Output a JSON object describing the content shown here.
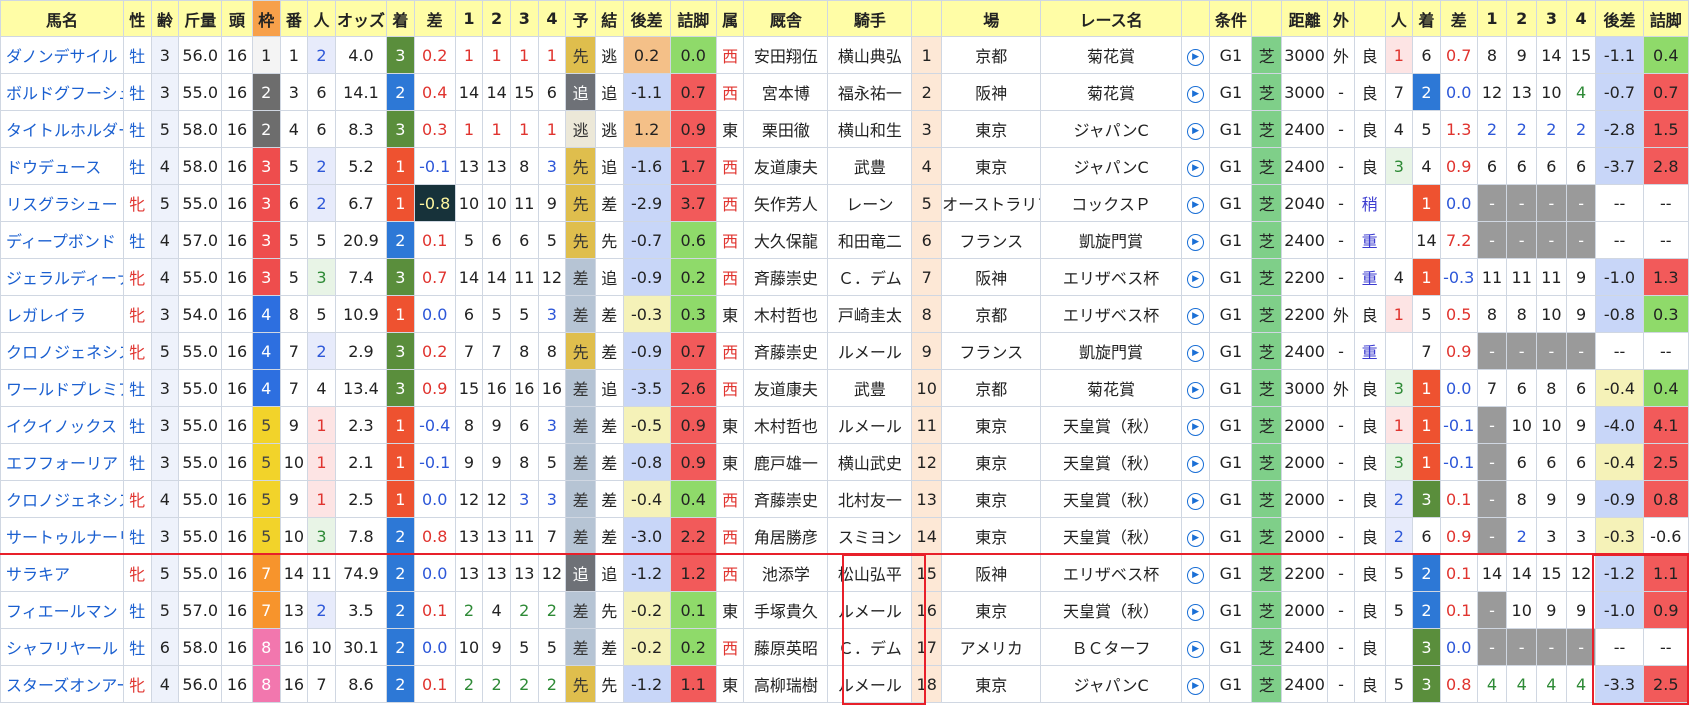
{
  "headers": [
    "馬名",
    "性",
    "齢",
    "斤量",
    "頭",
    "枠",
    "番",
    "人",
    "オッズ",
    "着",
    "差",
    "1",
    "2",
    "3",
    "4",
    "予",
    "結",
    "後差",
    "詰脚",
    "属",
    "厩舎",
    "騎手",
    "",
    "場",
    "レース名",
    "",
    "条件",
    "",
    "距離",
    "外",
    "",
    "人",
    "着",
    "差",
    "1",
    "2",
    "3",
    "4",
    "後差",
    "詰脚"
  ],
  "rows": [
    {
      "name": "ダノンデサイル",
      "sex": "牡",
      "age": "3",
      "wt": "56.0",
      "field": "16",
      "frame": "1",
      "num": "1",
      "pop": "2",
      "odds": "4.0",
      "fin": "3",
      "diff": "0.2",
      "c1": "1",
      "c2": "1",
      "c3": "1",
      "c4": "1",
      "pred": "先",
      "res": "逃",
      "gap": "0.2",
      "ts": "0.0",
      "org": "西",
      "trainer": "安田翔伍",
      "jockey": "横山典弘",
      "idx": "1",
      "venue": "京都",
      "race": "菊花賞",
      "grade": "G1",
      "surf": "芝",
      "dist": "3000",
      "out": "外",
      "cond": "良",
      "ppop": "1",
      "pfin": "6",
      "pdiff": "0.7",
      "pc1": "8",
      "pc2": "9",
      "pc3": "14",
      "pc4": "15",
      "pgap": "-1.1",
      "pts": "0.4"
    },
    {
      "name": "ボルドグフーシュ",
      "sex": "牡",
      "age": "3",
      "wt": "55.0",
      "field": "16",
      "frame": "2",
      "num": "3",
      "pop": "6",
      "odds": "14.1",
      "fin": "2",
      "diff": "0.4",
      "c1": "14",
      "c2": "14",
      "c3": "15",
      "c4": "6",
      "pred": "追",
      "res": "追",
      "gap": "-1.1",
      "ts": "0.7",
      "org": "西",
      "trainer": "宮本博",
      "jockey": "福永祐一",
      "idx": "2",
      "venue": "阪神",
      "race": "菊花賞",
      "grade": "G1",
      "surf": "芝",
      "dist": "3000",
      "out": "-",
      "cond": "良",
      "ppop": "7",
      "pfin": "2",
      "pdiff": "0.0",
      "pc1": "12",
      "pc2": "13",
      "pc3": "10",
      "pc4": "4",
      "pgap": "-0.7",
      "pts": "0.7"
    },
    {
      "name": "タイトルホルダー",
      "sex": "牡",
      "age": "5",
      "wt": "58.0",
      "field": "16",
      "frame": "2",
      "num": "4",
      "pop": "6",
      "odds": "8.3",
      "fin": "3",
      "diff": "0.3",
      "c1": "1",
      "c2": "1",
      "c3": "1",
      "c4": "1",
      "pred": "逃",
      "res": "逃",
      "gap": "1.2",
      "ts": "0.9",
      "org": "東",
      "trainer": "栗田徹",
      "jockey": "横山和生",
      "idx": "3",
      "venue": "東京",
      "race": "ジャパンC",
      "grade": "G1",
      "surf": "芝",
      "dist": "2400",
      "out": "-",
      "cond": "良",
      "ppop": "4",
      "pfin": "5",
      "pdiff": "1.3",
      "pc1": "2",
      "pc2": "2",
      "pc3": "2",
      "pc4": "2",
      "pgap": "-2.8",
      "pts": "1.5"
    },
    {
      "name": "ドウデュース",
      "sex": "牡",
      "age": "4",
      "wt": "58.0",
      "field": "16",
      "frame": "3",
      "num": "5",
      "pop": "2",
      "odds": "5.2",
      "fin": "1",
      "diff": "-0.1",
      "c1": "13",
      "c2": "13",
      "c3": "8",
      "c4": "3",
      "pred": "先",
      "res": "追",
      "gap": "-1.6",
      "ts": "1.7",
      "org": "西",
      "trainer": "友道康夫",
      "jockey": "武豊",
      "idx": "4",
      "venue": "東京",
      "race": "ジャパンC",
      "grade": "G1",
      "surf": "芝",
      "dist": "2400",
      "out": "-",
      "cond": "良",
      "ppop": "3",
      "pfin": "4",
      "pdiff": "0.9",
      "pc1": "6",
      "pc2": "6",
      "pc3": "6",
      "pc4": "6",
      "pgap": "-3.7",
      "pts": "2.8"
    },
    {
      "name": "リスグラシュー",
      "sex": "牝",
      "age": "5",
      "wt": "55.0",
      "field": "16",
      "frame": "3",
      "num": "6",
      "pop": "2",
      "odds": "6.7",
      "fin": "1",
      "diff": "-0.8",
      "c1": "10",
      "c2": "10",
      "c3": "11",
      "c4": "9",
      "pred": "先",
      "res": "差",
      "gap": "-2.9",
      "ts": "3.7",
      "org": "西",
      "trainer": "矢作芳人",
      "jockey": "レーン",
      "idx": "5",
      "venue": "オーストラリア",
      "race": "コックスＰ",
      "grade": "G1",
      "surf": "芝",
      "dist": "2040",
      "out": "-",
      "cond": "稍",
      "ppop": "",
      "pfin": "1",
      "pdiff": "0.0",
      "pc1": "-",
      "pc2": "-",
      "pc3": "-",
      "pc4": "-",
      "pgap": "--",
      "pts": "--"
    },
    {
      "name": "ディープボンド",
      "sex": "牡",
      "age": "4",
      "wt": "57.0",
      "field": "16",
      "frame": "3",
      "num": "5",
      "pop": "5",
      "odds": "20.9",
      "fin": "2",
      "diff": "0.1",
      "c1": "5",
      "c2": "6",
      "c3": "6",
      "c4": "5",
      "pred": "先",
      "res": "先",
      "gap": "-0.7",
      "ts": "0.6",
      "org": "西",
      "trainer": "大久保龍",
      "jockey": "和田竜二",
      "idx": "6",
      "venue": "フランス",
      "race": "凱旋門賞",
      "grade": "G1",
      "surf": "芝",
      "dist": "2400",
      "out": "-",
      "cond": "重",
      "ppop": "",
      "pfin": "14",
      "pdiff": "7.2",
      "pc1": "-",
      "pc2": "-",
      "pc3": "-",
      "pc4": "-",
      "pgap": "--",
      "pts": "--"
    },
    {
      "name": "ジェラルディーナ",
      "sex": "牝",
      "age": "4",
      "wt": "55.0",
      "field": "16",
      "frame": "3",
      "num": "5",
      "pop": "3",
      "odds": "7.4",
      "fin": "3",
      "diff": "0.7",
      "c1": "14",
      "c2": "14",
      "c3": "11",
      "c4": "12",
      "pred": "差",
      "res": "追",
      "gap": "-0.9",
      "ts": "0.2",
      "org": "西",
      "trainer": "斉藤崇史",
      "jockey": "Ｃ．デム",
      "idx": "7",
      "venue": "阪神",
      "race": "エリザベス杯",
      "grade": "G1",
      "surf": "芝",
      "dist": "2200",
      "out": "-",
      "cond": "重",
      "ppop": "4",
      "pfin": "1",
      "pdiff": "-0.3",
      "pc1": "11",
      "pc2": "11",
      "pc3": "11",
      "pc4": "9",
      "pgap": "-1.0",
      "pts": "1.3"
    },
    {
      "name": "レガレイラ",
      "sex": "牝",
      "age": "3",
      "wt": "54.0",
      "field": "16",
      "frame": "4",
      "num": "8",
      "pop": "5",
      "odds": "10.9",
      "fin": "1",
      "diff": "0.0",
      "c1": "6",
      "c2": "5",
      "c3": "5",
      "c4": "3",
      "pred": "差",
      "res": "差",
      "gap": "-0.3",
      "ts": "0.3",
      "org": "東",
      "trainer": "木村哲也",
      "jockey": "戸崎圭太",
      "idx": "8",
      "venue": "京都",
      "race": "エリザベス杯",
      "grade": "G1",
      "surf": "芝",
      "dist": "2200",
      "out": "外",
      "cond": "良",
      "ppop": "1",
      "pfin": "5",
      "pdiff": "0.5",
      "pc1": "8",
      "pc2": "8",
      "pc3": "10",
      "pc4": "9",
      "pgap": "-0.8",
      "pts": "0.3"
    },
    {
      "name": "クロノジェネシス",
      "sex": "牝",
      "age": "5",
      "wt": "55.0",
      "field": "16",
      "frame": "4",
      "num": "7",
      "pop": "2",
      "odds": "2.9",
      "fin": "3",
      "diff": "0.2",
      "c1": "7",
      "c2": "7",
      "c3": "8",
      "c4": "8",
      "pred": "先",
      "res": "差",
      "gap": "-0.9",
      "ts": "0.7",
      "org": "西",
      "trainer": "斉藤崇史",
      "jockey": "ルメール",
      "idx": "9",
      "venue": "フランス",
      "race": "凱旋門賞",
      "grade": "G1",
      "surf": "芝",
      "dist": "2400",
      "out": "-",
      "cond": "重",
      "ppop": "",
      "pfin": "7",
      "pdiff": "0.9",
      "pc1": "-",
      "pc2": "-",
      "pc3": "-",
      "pc4": "-",
      "pgap": "--",
      "pts": "--"
    },
    {
      "name": "ワールドプレミア",
      "sex": "牡",
      "age": "3",
      "wt": "55.0",
      "field": "16",
      "frame": "4",
      "num": "7",
      "pop": "4",
      "odds": "13.4",
      "fin": "3",
      "diff": "0.9",
      "c1": "15",
      "c2": "16",
      "c3": "16",
      "c4": "16",
      "pred": "差",
      "res": "追",
      "gap": "-3.5",
      "ts": "2.6",
      "org": "西",
      "trainer": "友道康夫",
      "jockey": "武豊",
      "idx": "10",
      "venue": "京都",
      "race": "菊花賞",
      "grade": "G1",
      "surf": "芝",
      "dist": "3000",
      "out": "外",
      "cond": "良",
      "ppop": "3",
      "pfin": "1",
      "pdiff": "0.0",
      "pc1": "7",
      "pc2": "6",
      "pc3": "8",
      "pc4": "6",
      "pgap": "-0.4",
      "pts": "0.4"
    },
    {
      "name": "イクイノックス",
      "sex": "牡",
      "age": "3",
      "wt": "55.0",
      "field": "16",
      "frame": "5",
      "num": "9",
      "pop": "1",
      "odds": "2.3",
      "fin": "1",
      "diff": "-0.4",
      "c1": "8",
      "c2": "9",
      "c3": "6",
      "c4": "3",
      "pred": "差",
      "res": "差",
      "gap": "-0.5",
      "ts": "0.9",
      "org": "東",
      "trainer": "木村哲也",
      "jockey": "ルメール",
      "idx": "11",
      "venue": "東京",
      "race": "天皇賞（秋）",
      "grade": "G1",
      "surf": "芝",
      "dist": "2000",
      "out": "-",
      "cond": "良",
      "ppop": "1",
      "pfin": "1",
      "pdiff": "-0.1",
      "pc1": "-",
      "pc2": "10",
      "pc3": "10",
      "pc4": "9",
      "pgap": "-4.0",
      "pts": "4.1"
    },
    {
      "name": "エフフォーリア",
      "sex": "牡",
      "age": "3",
      "wt": "55.0",
      "field": "16",
      "frame": "5",
      "num": "10",
      "pop": "1",
      "odds": "2.1",
      "fin": "1",
      "diff": "-0.1",
      "c1": "9",
      "c2": "9",
      "c3": "8",
      "c4": "5",
      "pred": "差",
      "res": "差",
      "gap": "-0.8",
      "ts": "0.9",
      "org": "東",
      "trainer": "鹿戸雄一",
      "jockey": "横山武史",
      "idx": "12",
      "venue": "東京",
      "race": "天皇賞（秋）",
      "grade": "G1",
      "surf": "芝",
      "dist": "2000",
      "out": "-",
      "cond": "良",
      "ppop": "3",
      "pfin": "1",
      "pdiff": "-0.1",
      "pc1": "-",
      "pc2": "6",
      "pc3": "6",
      "pc4": "6",
      "pgap": "-0.4",
      "pts": "2.5"
    },
    {
      "name": "クロノジェネシス",
      "sex": "牝",
      "age": "4",
      "wt": "55.0",
      "field": "16",
      "frame": "5",
      "num": "9",
      "pop": "1",
      "odds": "2.5",
      "fin": "1",
      "diff": "0.0",
      "c1": "12",
      "c2": "12",
      "c3": "3",
      "c4": "3",
      "pred": "差",
      "res": "差",
      "gap": "-0.4",
      "ts": "0.4",
      "org": "西",
      "trainer": "斉藤崇史",
      "jockey": "北村友一",
      "idx": "13",
      "venue": "東京",
      "race": "天皇賞（秋）",
      "grade": "G1",
      "surf": "芝",
      "dist": "2000",
      "out": "-",
      "cond": "良",
      "ppop": "2",
      "pfin": "3",
      "pdiff": "0.1",
      "pc1": "-",
      "pc2": "8",
      "pc3": "9",
      "pc4": "9",
      "pgap": "-0.9",
      "pts": "0.8"
    },
    {
      "name": "サートゥルナーリア",
      "sex": "牡",
      "age": "3",
      "wt": "55.0",
      "field": "16",
      "frame": "5",
      "num": "10",
      "pop": "3",
      "odds": "7.8",
      "fin": "2",
      "diff": "0.8",
      "c1": "13",
      "c2": "13",
      "c3": "11",
      "c4": "7",
      "pred": "差",
      "res": "差",
      "gap": "-3.0",
      "ts": "2.2",
      "org": "西",
      "trainer": "角居勝彦",
      "jockey": "スミヨン",
      "idx": "14",
      "venue": "東京",
      "race": "天皇賞（秋）",
      "grade": "G1",
      "surf": "芝",
      "dist": "2000",
      "out": "-",
      "cond": "良",
      "ppop": "2",
      "pfin": "6",
      "pdiff": "0.9",
      "pc1": "-",
      "pc2": "2",
      "pc3": "3",
      "pc4": "3",
      "pgap": "-0.3",
      "pts": "-0.6"
    },
    {
      "name": "サラキア",
      "sex": "牝",
      "age": "5",
      "wt": "55.0",
      "field": "16",
      "frame": "7",
      "num": "14",
      "pop": "11",
      "odds": "74.9",
      "fin": "2",
      "diff": "0.0",
      "c1": "13",
      "c2": "13",
      "c3": "13",
      "c4": "12",
      "pred": "追",
      "res": "追",
      "gap": "-1.2",
      "ts": "1.2",
      "org": "西",
      "trainer": "池添学",
      "jockey": "松山弘平",
      "idx": "15",
      "venue": "阪神",
      "race": "エリザベス杯",
      "grade": "G1",
      "surf": "芝",
      "dist": "2200",
      "out": "-",
      "cond": "良",
      "ppop": "5",
      "pfin": "2",
      "pdiff": "0.1",
      "pc1": "14",
      "pc2": "14",
      "pc3": "15",
      "pc4": "12",
      "pgap": "-1.2",
      "pts": "1.1"
    },
    {
      "name": "フィエールマン",
      "sex": "牡",
      "age": "5",
      "wt": "57.0",
      "field": "16",
      "frame": "7",
      "num": "13",
      "pop": "2",
      "odds": "3.5",
      "fin": "2",
      "diff": "0.1",
      "c1": "2",
      "c2": "4",
      "c3": "2",
      "c4": "2",
      "pred": "差",
      "res": "先",
      "gap": "-0.2",
      "ts": "0.1",
      "org": "東",
      "trainer": "手塚貴久",
      "jockey": "ルメール",
      "idx": "16",
      "venue": "東京",
      "race": "天皇賞（秋）",
      "grade": "G1",
      "surf": "芝",
      "dist": "2000",
      "out": "-",
      "cond": "良",
      "ppop": "5",
      "pfin": "2",
      "pdiff": "0.1",
      "pc1": "-",
      "pc2": "10",
      "pc3": "9",
      "pc4": "9",
      "pgap": "-1.0",
      "pts": "0.9"
    },
    {
      "name": "シャフリヤール",
      "sex": "牡",
      "age": "6",
      "wt": "58.0",
      "field": "16",
      "frame": "8",
      "num": "16",
      "pop": "10",
      "odds": "30.1",
      "fin": "2",
      "diff": "0.0",
      "c1": "10",
      "c2": "9",
      "c3": "5",
      "c4": "5",
      "pred": "差",
      "res": "差",
      "gap": "-0.2",
      "ts": "0.2",
      "org": "西",
      "trainer": "藤原英昭",
      "jockey": "Ｃ．デム",
      "idx": "17",
      "venue": "アメリカ",
      "race": "ＢＣターフ",
      "grade": "G1",
      "surf": "芝",
      "dist": "2400",
      "out": "-",
      "cond": "良",
      "ppop": "",
      "pfin": "3",
      "pdiff": "0.0",
      "pc1": "-",
      "pc2": "-",
      "pc3": "-",
      "pc4": "-",
      "pgap": "--",
      "pts": "--"
    },
    {
      "name": "スターズオンアース",
      "sex": "牝",
      "age": "4",
      "wt": "56.0",
      "field": "16",
      "frame": "8",
      "num": "16",
      "pop": "7",
      "odds": "8.6",
      "fin": "2",
      "diff": "0.1",
      "c1": "2",
      "c2": "2",
      "c3": "2",
      "c4": "2",
      "pred": "先",
      "res": "先",
      "gap": "-1.2",
      "ts": "1.1",
      "org": "東",
      "trainer": "高柳瑞樹",
      "jockey": "ルメール",
      "idx": "18",
      "venue": "東京",
      "race": "ジャパンC",
      "grade": "G1",
      "surf": "芝",
      "dist": "2400",
      "out": "-",
      "cond": "良",
      "ppop": "5",
      "pfin": "3",
      "pdiff": "0.8",
      "pc1": "4",
      "pc2": "4",
      "pc3": "4",
      "pc4": "4",
      "pgap": "-3.3",
      "pts": "2.5"
    }
  ],
  "colors": {
    "frame1": "#f4f4f4",
    "frame2": "#6d6d6d",
    "frame3": "#ee4d4d",
    "frame4": "#2d6fe0",
    "frame5": "#f2d32a",
    "frame7": "#f7942c",
    "frame8": "#f277ae",
    "header": "#fffda6",
    "highlight": "#e8202a"
  },
  "icons": {
    "race_link": "play-circle-icon"
  }
}
